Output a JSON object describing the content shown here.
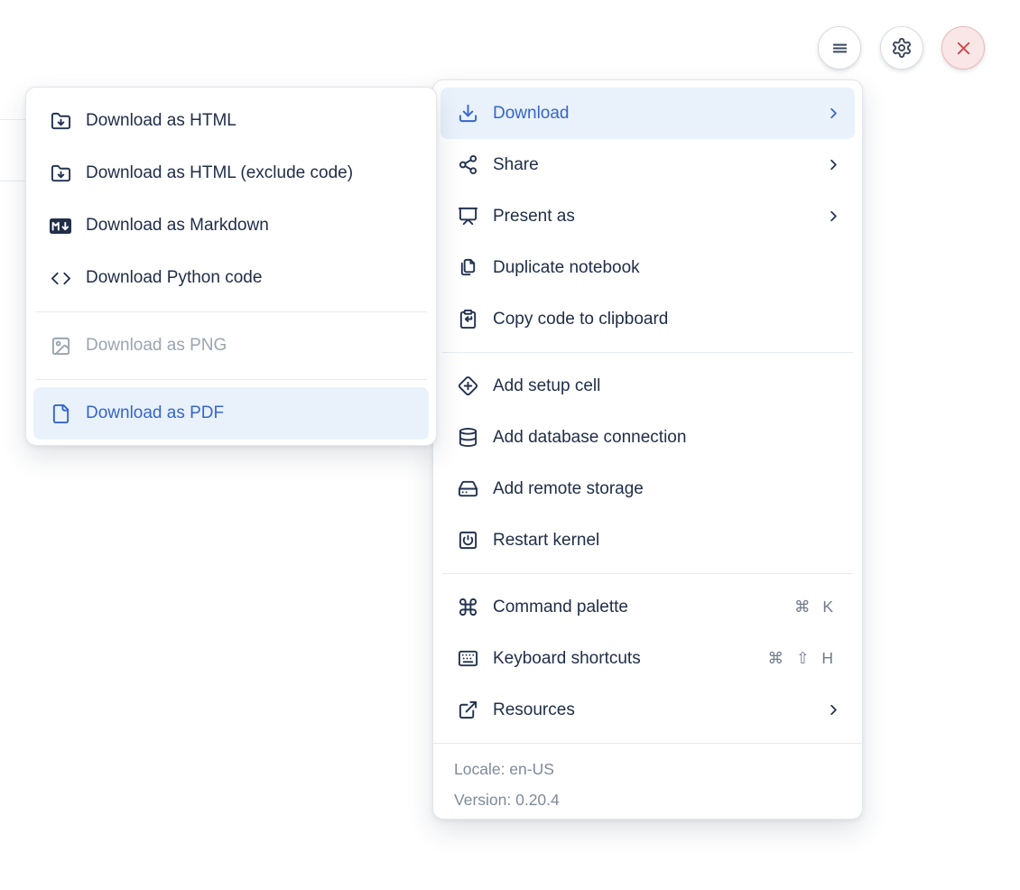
{
  "toolbar": {
    "buttons": [
      {
        "name": "notebook-menu",
        "icon": "hamburger-icon"
      },
      {
        "name": "settings",
        "icon": "gear-icon"
      },
      {
        "name": "shutdown",
        "icon": "close-icon"
      }
    ]
  },
  "main_menu": {
    "items": [
      {
        "label": "Download",
        "icon": "download-icon",
        "has_submenu": true,
        "state": "active"
      },
      {
        "label": "Share",
        "icon": "share-icon",
        "has_submenu": true
      },
      {
        "label": "Present as",
        "icon": "presentation-icon",
        "has_submenu": true
      },
      {
        "label": "Duplicate notebook",
        "icon": "duplicate-icon"
      },
      {
        "label": "Copy code to clipboard",
        "icon": "clipboard-copy-icon"
      },
      {
        "label": "Add setup cell",
        "icon": "diamond-plus-icon"
      },
      {
        "label": "Add database connection",
        "icon": "database-icon"
      },
      {
        "label": "Add remote storage",
        "icon": "hard-drive-icon"
      },
      {
        "label": "Restart kernel",
        "icon": "square-power-icon"
      },
      {
        "label": "Command palette",
        "icon": "command-icon",
        "shortcut": "⌘ K"
      },
      {
        "label": "Keyboard shortcuts",
        "icon": "keyboard-icon",
        "shortcut": "⌘ ⇧ H"
      },
      {
        "label": "Resources",
        "icon": "external-link-icon",
        "has_submenu": true
      }
    ],
    "footer": {
      "locale": "Locale: en-US",
      "version": "Version: 0.20.4"
    }
  },
  "submenu": {
    "items": [
      {
        "label": "Download as HTML",
        "icon": "folder-down-icon"
      },
      {
        "label": "Download as HTML (exclude code)",
        "icon": "folder-down-icon"
      },
      {
        "label": "Download as Markdown",
        "icon": "markdown-icon"
      },
      {
        "label": "Download Python code",
        "icon": "code-icon"
      },
      {
        "label": "Download as PNG",
        "icon": "image-icon",
        "disabled": true
      },
      {
        "label": "Download as PDF",
        "icon": "file-icon",
        "state": "active"
      }
    ]
  },
  "colors": {
    "accent": "#3566cb",
    "accent_bg": "#e9f1fb",
    "text": "#202e48",
    "disabled": "#9aa5b1",
    "muted": "#7e8a9a",
    "danger": "#ca4646",
    "danger_bg": "#f9e6e6"
  }
}
